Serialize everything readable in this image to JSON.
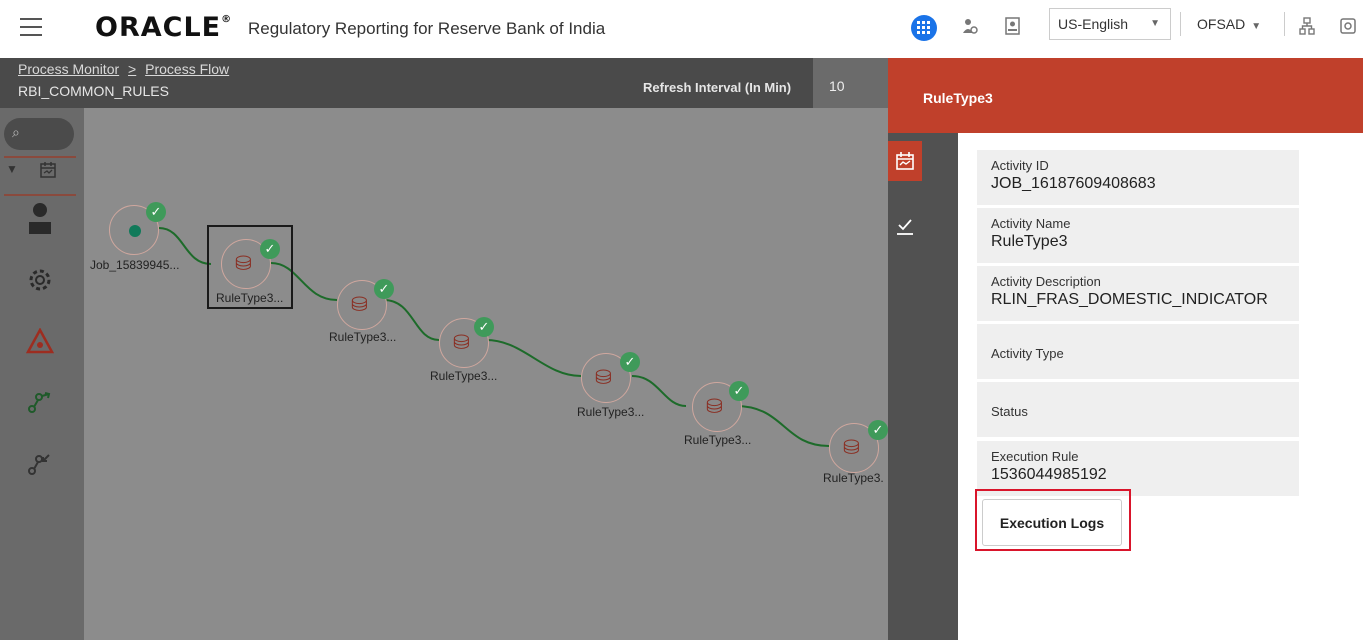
{
  "header": {
    "brand": "ORACLE",
    "brand_mark": "®",
    "app_title": "Regulatory Reporting for Reserve Bank of India",
    "language": "US-English",
    "user": "OFSAD",
    "accent": "#1a73e8"
  },
  "subheader": {
    "breadcrumb": [
      "Process Monitor",
      "Process Flow"
    ],
    "breadcrumb_sep": ">",
    "process_name": "RBI_COMMON_RULES",
    "refresh_label": "Refresh Interval (In Min)",
    "refresh_value": "10"
  },
  "flow": {
    "nodes": [
      {
        "label": "Job_15839945...",
        "icon": "start-node-icon",
        "status": "completed"
      },
      {
        "label": "RuleType3...",
        "icon": "database-rule-icon",
        "status": "completed",
        "selected": true
      },
      {
        "label": "RuleType3...",
        "icon": "database-rule-icon",
        "status": "completed"
      },
      {
        "label": "RuleType3...",
        "icon": "database-rule-icon",
        "status": "completed"
      },
      {
        "label": "RuleType3...",
        "icon": "database-rule-icon",
        "status": "completed"
      },
      {
        "label": "RuleType3...",
        "icon": "database-rule-icon",
        "status": "completed"
      },
      {
        "label": "RuleType3.",
        "icon": "database-rule-icon",
        "status": "completed"
      }
    ]
  },
  "panel": {
    "title": "RuleType3",
    "accent": "#c0402b",
    "tabs": [
      "activity-details-icon",
      "checklist-icon"
    ],
    "fields": [
      {
        "label": "Activity ID",
        "value": "JOB_16187609408683"
      },
      {
        "label": "Activity Name",
        "value": "RuleType3"
      },
      {
        "label": "Activity Description",
        "value": "RLIN_FRAS_DOMESTIC_INDICATOR"
      },
      {
        "label": "Activity Type",
        "value": ""
      },
      {
        "label": "Status",
        "value": ""
      },
      {
        "label": "Execution Rule",
        "value": "1536044985192"
      }
    ],
    "exec_logs_button": "Execution Logs",
    "highlight_color": "#d9152b"
  }
}
